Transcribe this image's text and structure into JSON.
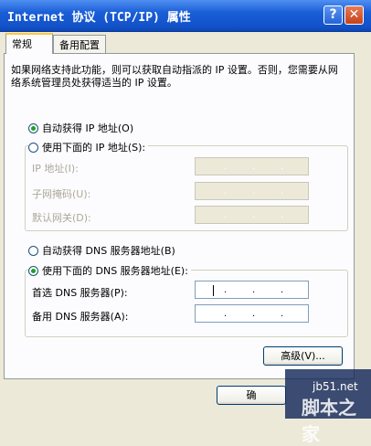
{
  "window": {
    "title": "Internet 协议 (TCP/IP) 属性",
    "help_label": "?",
    "close_label": "✕"
  },
  "tabs": [
    {
      "label": "常规",
      "selected": true
    },
    {
      "label": "备用配置",
      "selected": false
    }
  ],
  "description": "如果网络支持此功能，则可以获取自动指派的 IP 设置。否则，您需要从网络系统管理员处获得适当的 IP 设置。",
  "ip_section": {
    "auto_label": "自动获得 IP 地址(O)",
    "auto_selected": true,
    "manual_label": "使用下面的 IP 地址(S):",
    "manual_selected": false,
    "fields": [
      {
        "label": "IP 地址(I):",
        "value": ""
      },
      {
        "label": "子网掩码(U):",
        "value": ""
      },
      {
        "label": "默认网关(D):",
        "value": ""
      }
    ]
  },
  "dns_section": {
    "auto_label": "自动获得 DNS 服务器地址(B)",
    "auto_selected": false,
    "manual_label": "使用下面的 DNS 服务器地址(E):",
    "manual_selected": true,
    "fields": [
      {
        "label": "首选 DNS 服务器(P):",
        "value": ""
      },
      {
        "label": "备用 DNS 服务器(A):",
        "value": ""
      }
    ]
  },
  "advanced_label": "高级(V)...",
  "ok_label": "确",
  "watermark": {
    "small": "jb51.net",
    "big": "脚本之家"
  },
  "colors": {
    "titlebar": "#1252c9",
    "dialog_bg": "#ece9d8",
    "panel_bg": "#fcfcfe",
    "tab_highlight": "#ffc83c"
  }
}
